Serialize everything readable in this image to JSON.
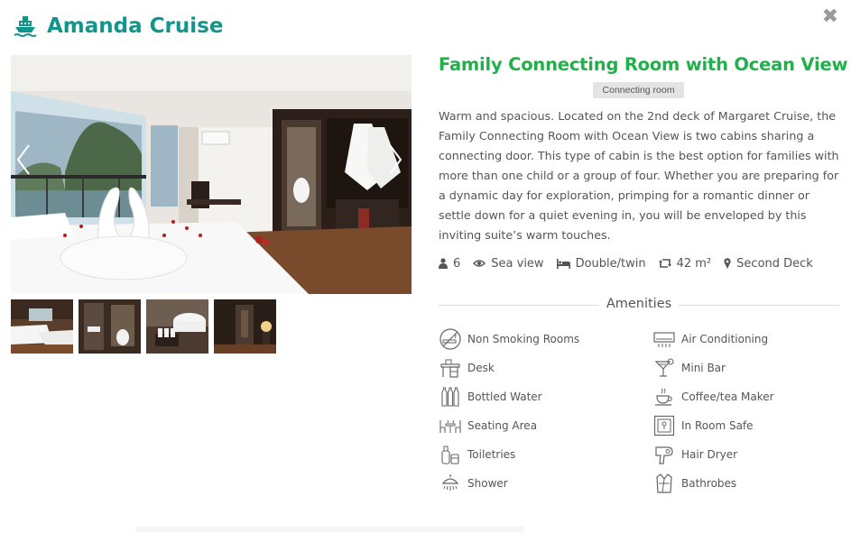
{
  "header": {
    "brand": "Amanda Cruise",
    "brand_icon": "ship-icon",
    "close_icon": "close-icon",
    "colors": {
      "brand": "#12958d"
    }
  },
  "gallery": {
    "main_photo": "cabin-photo",
    "prev_icon": "chevron-left-icon",
    "next_icon": "chevron-right-icon",
    "thumbnails": [
      "twin-beds-photo",
      "bathroom-photo",
      "bathtub-photo",
      "hallway-photo"
    ]
  },
  "room": {
    "title": "Family Connecting Room with Ocean View",
    "badge": "Connecting room",
    "description": "Warm and spacious. Located on the 2nd deck of Margaret Cruise, the Family Connecting Room with Ocean View is two cabins sharing a connecting door. This type of cabin is the best option for families with more than one child or a group of four. Whether you are preparing for a dynamic day for exploration, primping for a romantic dinner or settle down for a quiet evening in, you will be enveloped by this inviting suite’s warm touches.",
    "colors": {
      "title": "#21b14a",
      "badge_bg": "#e4e4e4"
    }
  },
  "specs": [
    {
      "icon": "user-icon",
      "text": "6"
    },
    {
      "icon": "eye-icon",
      "text": "Sea view"
    },
    {
      "icon": "bed-icon",
      "text": "Double/twin"
    },
    {
      "icon": "area-icon",
      "text": "42 m²"
    },
    {
      "icon": "map-marker-icon",
      "text": "Second Deck"
    }
  ],
  "amenities": {
    "heading": "Amenities",
    "items": [
      {
        "icon": "no-smoking-icon",
        "label": "Non Smoking Rooms"
      },
      {
        "icon": "air-conditioner-icon",
        "label": "Air Conditioning"
      },
      {
        "icon": "desk-icon",
        "label": "Desk"
      },
      {
        "icon": "cocktail-icon",
        "label": "Mini Bar"
      },
      {
        "icon": "bottles-icon",
        "label": "Bottled Water"
      },
      {
        "icon": "coffee-cup-icon",
        "label": "Coffee/tea Maker"
      },
      {
        "icon": "seating-icon",
        "label": "Seating Area"
      },
      {
        "icon": "safe-icon",
        "label": "In Room Safe"
      },
      {
        "icon": "toiletries-icon",
        "label": "Toiletries"
      },
      {
        "icon": "hair-dryer-icon",
        "label": "Hair Dryer"
      },
      {
        "icon": "shower-icon",
        "label": "Shower"
      },
      {
        "icon": "bathrobe-icon",
        "label": "Bathrobes"
      }
    ]
  }
}
